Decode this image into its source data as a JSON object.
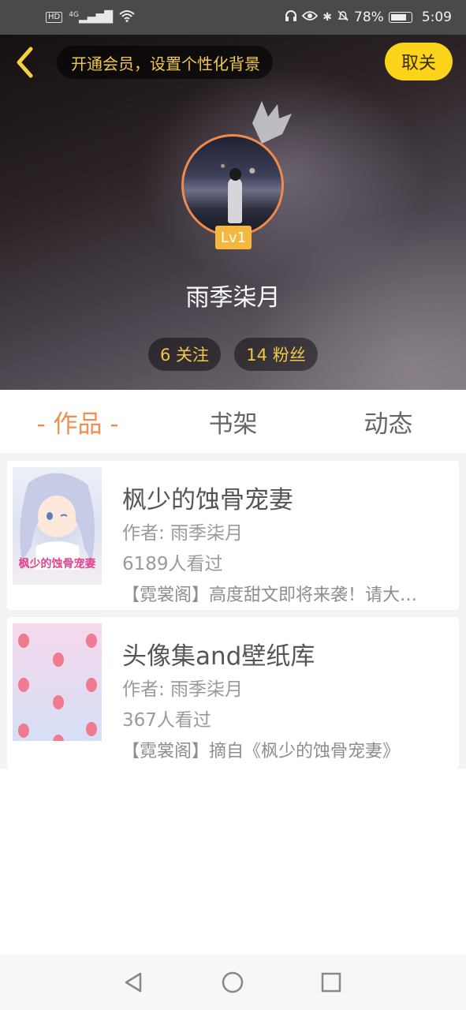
{
  "status_bar": {
    "signal_label": "4G",
    "battery": "78%",
    "time": "5:09"
  },
  "header": {
    "vip_banner": "开通会员，设置个性化背景",
    "unfollow_button": "取关",
    "level": "Lv1",
    "username": "雨季柒月",
    "following": "6 关注",
    "fans": "14 粉丝"
  },
  "tabs": [
    {
      "label": "- 作品 -",
      "active": true
    },
    {
      "label": "书架",
      "active": false
    },
    {
      "label": "动态",
      "active": false
    }
  ],
  "books": [
    {
      "title": "枫少的蚀骨宠妻",
      "author": "作者: 雨季柒月",
      "views": "6189人看过",
      "description": "【霓裳阁】高度甜文即将来袭！请大家多多支持",
      "cover_text": "枫少的蚀骨宠妻"
    },
    {
      "title": "头像集and壁纸库",
      "author": "作者: 雨季柒月",
      "views": "367人看过",
      "description": "【霓裳阁】摘自《枫少的蚀骨宠妻》"
    }
  ],
  "nav": {
    "back_icon": "triangle-back",
    "home_icon": "circle-home",
    "recent_icon": "square-recent"
  },
  "colors": {
    "accent_orange": "#f28d4f",
    "accent_yellow": "#fbd31a",
    "gold_text": "#f1c94a"
  }
}
